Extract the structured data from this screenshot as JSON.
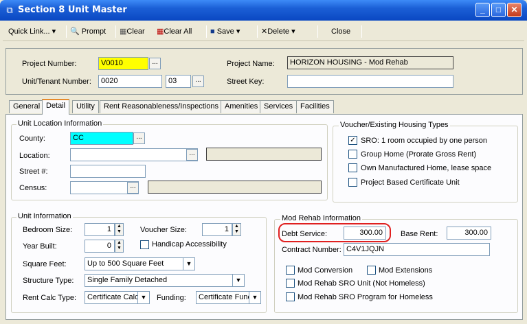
{
  "window": {
    "title": "Section 8 Unit Master",
    "min": "_",
    "max": "□",
    "close": "✕"
  },
  "toolbar": {
    "quick_link": "Quick Link...",
    "prompt": "Prompt",
    "clear": "Clear",
    "clear_all": "Clear All",
    "save": "Save",
    "delete": "Delete",
    "close": "Close"
  },
  "header": {
    "project_number_label": "Project Number:",
    "project_number": "V0010",
    "project_name_label": "Project Name:",
    "project_name": "HORIZON HOUSING - Mod Rehab",
    "unit_tenant_label": "Unit/Tenant Number:",
    "unit_number": "0020",
    "tenant_number": "03",
    "street_key_label": "Street Key:",
    "street_key": ""
  },
  "tabs": [
    "General",
    "Detail",
    "Utility",
    "Rent Reasonableness/Inspections",
    "Amenities",
    "Services",
    "Facilities"
  ],
  "location": {
    "group_title": "Unit Location Information",
    "county_label": "County:",
    "county": "CC",
    "location_label": "Location:",
    "location": "",
    "location_desc": "",
    "street_label": "Street #:",
    "street": "",
    "census_label": "Census:",
    "census": "",
    "census_desc": ""
  },
  "voucher": {
    "group_title": "Voucher/Existing Housing Types",
    "options": [
      {
        "label": "SRO: 1 room occupied by one person",
        "checked": true
      },
      {
        "label": "Group Home (Prorate Gross Rent)",
        "checked": false
      },
      {
        "label": "Own Manufactured Home, lease space",
        "checked": false
      },
      {
        "label": "Project Based Certificate Unit",
        "checked": false
      }
    ]
  },
  "unit": {
    "group_title": "Unit Information",
    "bedroom_label": "Bedroom Size:",
    "bedroom": "1",
    "voucher_label": "Voucher Size:",
    "voucher": "1",
    "year_label": "Year Built:",
    "year": "0",
    "handicap_label": "Handicap Accessibility",
    "sqft_label": "Square Feet:",
    "sqft": "Up to 500 Square Feet",
    "structure_label": "Structure Type:",
    "structure": "Single Family Detached",
    "rentcalc_label": "Rent Calc Type:",
    "rentcalc": "Certificate Calc",
    "funding_label": "Funding:",
    "funding": "Certificate Func"
  },
  "modrehab": {
    "group_title": "Mod Rehab Information",
    "debt_label": "Debt Service:",
    "debt": "300.00",
    "base_label": "Base Rent:",
    "base": "300.00",
    "contract_label": "Contract Number:",
    "contract": "C4V1JQJN",
    "mod_conversion": "Mod Conversion",
    "mod_extensions": "Mod Extensions",
    "sro_not_homeless": "Mod Rehab SRO Unit (Not Homeless)",
    "sro_homeless": "Mod Rehab SRO Program for Homeless"
  }
}
